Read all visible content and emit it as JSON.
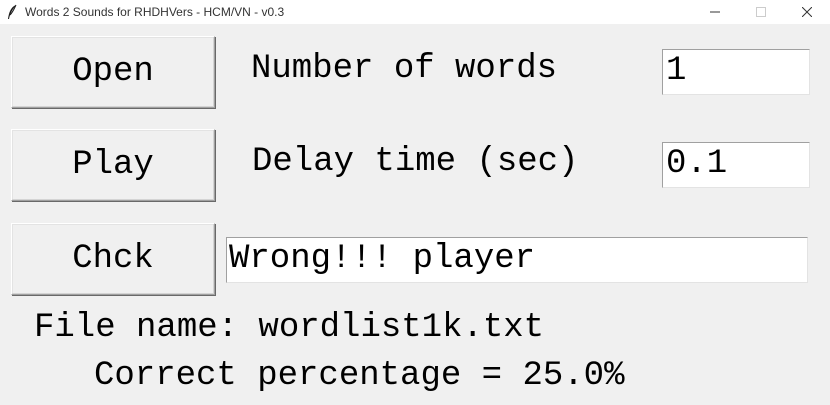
{
  "window": {
    "title": "Words 2 Sounds for RHDHVers - HCM/VN - v0.3",
    "app_icon": "feather-icon"
  },
  "buttons": {
    "open": "Open",
    "play": "Play",
    "check": "Chck"
  },
  "fields": {
    "number_of_words_label": "Number of words",
    "number_of_words_value": "1",
    "delay_time_label": "Delay time (sec)",
    "delay_time_value": "0.1",
    "answer_value": "Wrong!!! player"
  },
  "status": {
    "file_name": "File name: wordlist1k.txt",
    "correct_percentage": "Correct percentage = 25.0%"
  },
  "colors": {
    "background": "#f0f0f0",
    "titlebar": "#ffffff",
    "entry_background": "#ffffff"
  }
}
